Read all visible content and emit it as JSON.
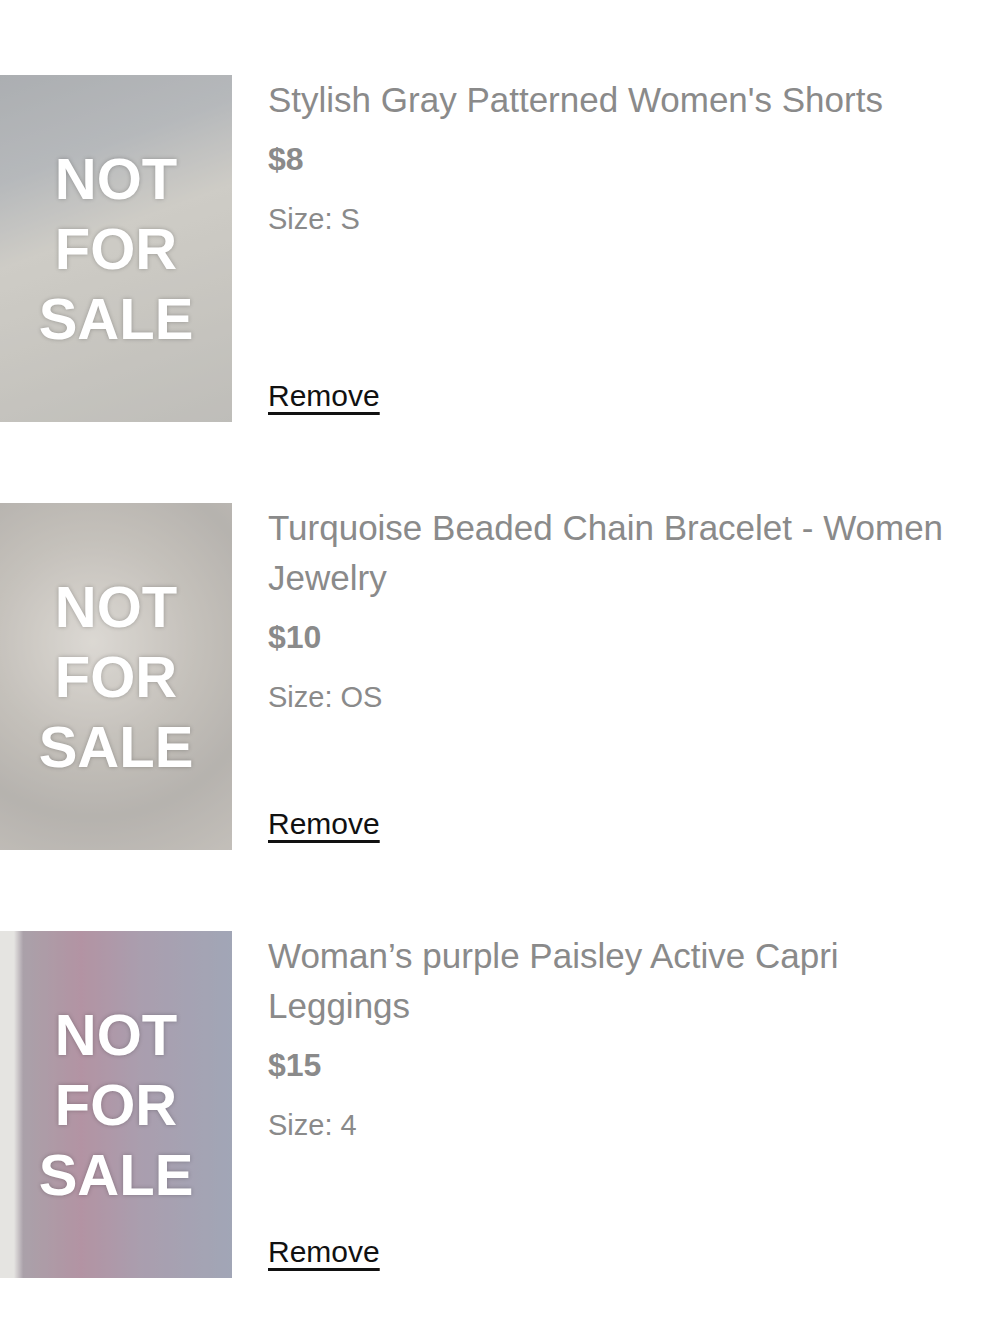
{
  "items": [
    {
      "title": "Stylish Gray Patterned Women's Shorts",
      "price": "$8",
      "size": "Size: S",
      "badge": "NOT FOR SALE",
      "action": "Remove",
      "unavailable": true
    },
    {
      "title": "Turquoise Beaded Chain Bracelet - Women Jewelry",
      "price": "$10",
      "size": "Size: OS",
      "badge": "NOT FOR SALE",
      "action": "Remove",
      "unavailable": true
    },
    {
      "title": "Woman’s purple Paisley Active Capri Leggings",
      "price": "$15",
      "size": "Size: 4",
      "badge": "NOT FOR SALE",
      "action": "Remove",
      "unavailable": true
    }
  ]
}
